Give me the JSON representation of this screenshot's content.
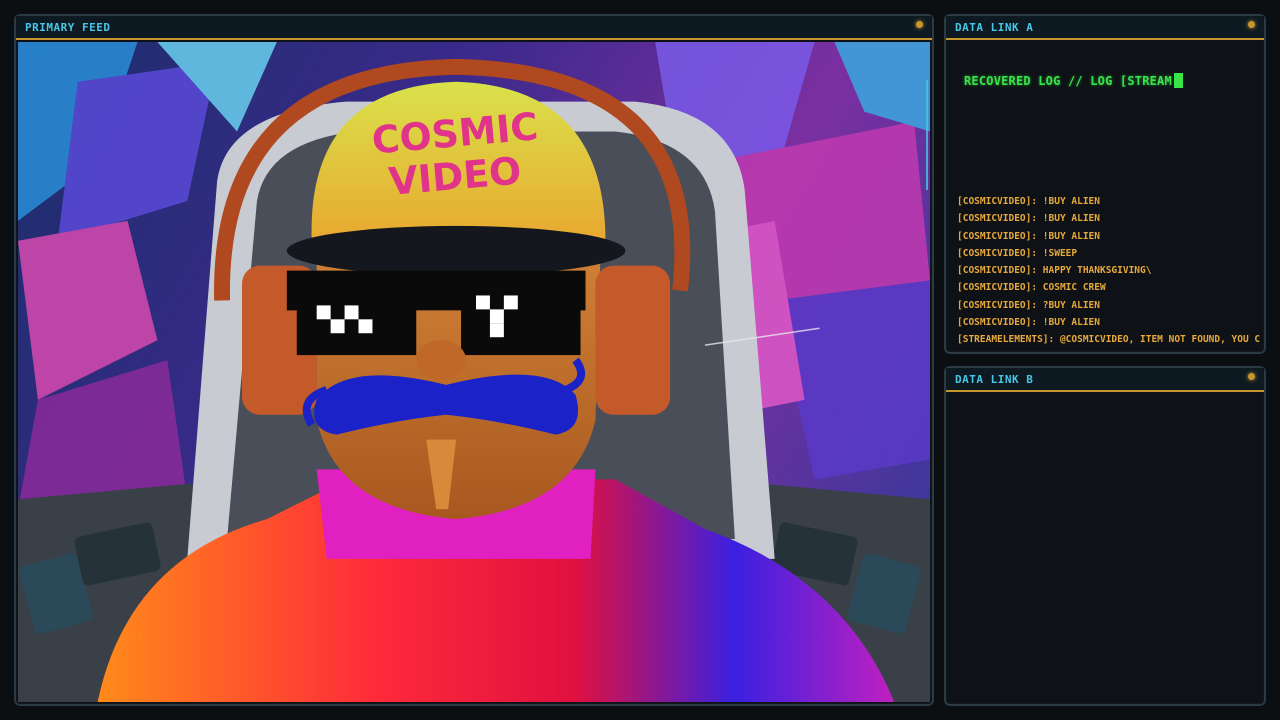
{
  "primary_feed": {
    "title": "PRIMARY FEED",
    "hat_text_line1": "COSMIC",
    "hat_text_line2": "VIDEO"
  },
  "data_link_a": {
    "title": "DATA LINK A",
    "recovered_text": "RECOVERED LOG // LOG [STREAM",
    "log_lines": [
      "[COSMICVIDEO]: !BUY ALIEN",
      "[COSMICVIDEO]: !BUY ALIEN",
      "[COSMICVIDEO]: !BUY ALIEN",
      "[COSMICVIDEO]: !SWEEP",
      "[COSMICVIDEO]: HAPPY THANKSGIVING\\",
      "[COSMICVIDEO]: COSMIC CREW",
      "[COSMICVIDEO]: ?BUY ALIEN",
      "[COSMICVIDEO]: !BUY ALIEN",
      "[STREAMELEMENTS]: @COSMICVIDEO, ITEM NOT FOUND, YOU CAN SI"
    ]
  },
  "data_link_b": {
    "title": "DATA LINK B"
  },
  "colors": {
    "accent_cyan": "#49c6e5",
    "accent_gold": "#c7962e",
    "terminal_green": "#39e34a",
    "log_orange": "#e7a93c"
  }
}
